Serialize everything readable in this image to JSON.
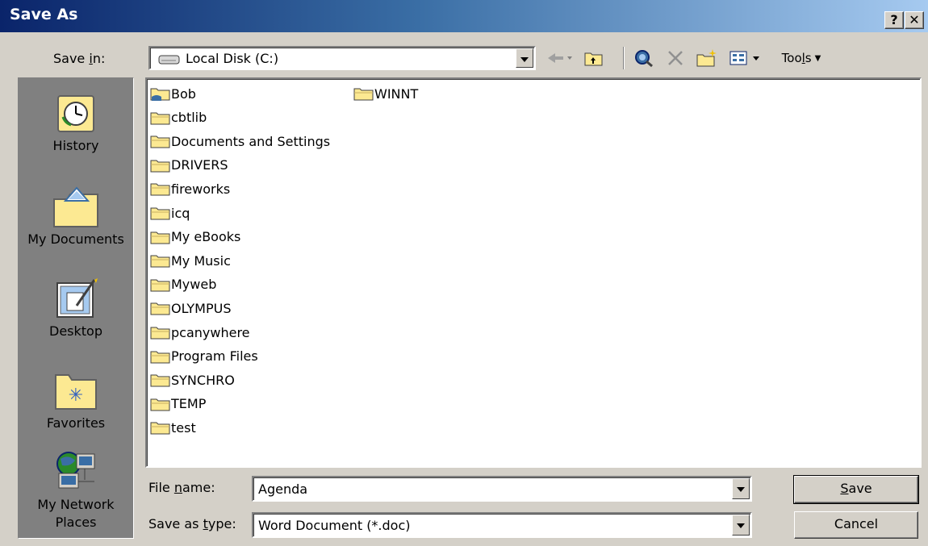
{
  "window": {
    "title": "Save As",
    "help_label": "?",
    "close_label": "✕"
  },
  "save_in": {
    "label_pre": "Save ",
    "label_ul": "i",
    "label_post": "n:",
    "value": "Local Disk (C:)"
  },
  "toolbar": {
    "tools_pre": "Too",
    "tools_ul": "l",
    "tools_post": "s"
  },
  "places": [
    {
      "id": "history",
      "label": "History",
      "icon": "history-icon"
    },
    {
      "id": "my-documents",
      "label": "My Documents",
      "icon": "my-documents-icon"
    },
    {
      "id": "desktop",
      "label": "Desktop",
      "icon": "desktop-icon"
    },
    {
      "id": "favorites",
      "label": "Favorites",
      "icon": "favorites-icon"
    },
    {
      "id": "my-network-places",
      "label": "My Network Places",
      "icon": "network-places-icon"
    }
  ],
  "files": {
    "column1": [
      "Bob",
      "cbtlib",
      "Documents and Settings",
      "DRIVERS",
      "fireworks",
      "icq",
      "My eBooks",
      "My Music",
      "Myweb",
      "OLYMPUS",
      "pcanywhere",
      "Program Files",
      "SYNCHRO",
      "TEMP",
      "test"
    ],
    "column2": [
      "WINNT"
    ]
  },
  "file_name": {
    "label_pre": "File ",
    "label_ul": "n",
    "label_post": "ame:",
    "value": "Agenda"
  },
  "save_as_type": {
    "label_pre": "Save as ",
    "label_ul": "t",
    "label_post": "ype:",
    "value": "Word Document (*.doc)"
  },
  "buttons": {
    "save_ul": "S",
    "save_rest": "ave",
    "cancel": "Cancel"
  },
  "colors": {
    "title_start": "#0a246a",
    "title_end": "#a6caf0",
    "folder": "#fce992",
    "dialog_bg": "#d4d0c8"
  }
}
